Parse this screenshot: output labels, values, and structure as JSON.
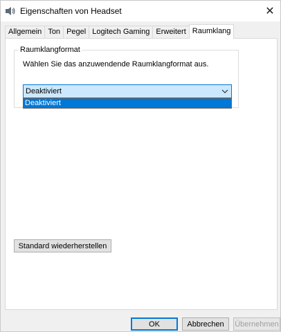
{
  "window": {
    "title": "Eigenschaften von Headset",
    "close_symbol": "✕",
    "icon": "speaker-icon"
  },
  "tabs": [
    {
      "label": "Allgemein",
      "active": false
    },
    {
      "label": "Ton",
      "active": false
    },
    {
      "label": "Pegel",
      "active": false
    },
    {
      "label": "Logitech Gaming",
      "active": false
    },
    {
      "label": "Erweitert",
      "active": false
    },
    {
      "label": "Raumklang",
      "active": true
    }
  ],
  "spatial": {
    "group_title": "Raumklangformat",
    "description": "Wählen Sie das anzuwendende Raumklangformat aus.",
    "selected_value": "Deaktiviert",
    "options": [
      "Deaktiviert"
    ],
    "highlighted_option": "Deaktiviert"
  },
  "buttons": {
    "restore_defaults": "Standard wiederherstellen",
    "ok": "OK",
    "cancel": "Abbrechen",
    "apply": "Übernehmen"
  },
  "colors": {
    "accent": "#0078d7",
    "combo_bg": "#cce8ff"
  }
}
